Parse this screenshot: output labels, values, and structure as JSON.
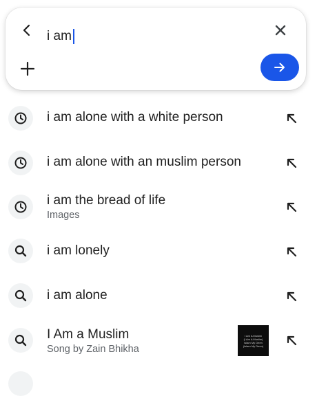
{
  "search": {
    "query": "i am",
    "back_icon": "arrow-left-icon",
    "clear_icon": "close-icon",
    "add_icon": "plus-icon",
    "submit_icon": "arrow-right-icon",
    "accent_color": "#1a56e8"
  },
  "suggestions": [
    {
      "icon": "history-clock-icon",
      "title": "i am alone with a white person"
    },
    {
      "icon": "history-clock-icon",
      "title": "i am alone with an muslim person"
    },
    {
      "icon": "history-clock-icon",
      "title": "i am the bread of life",
      "subtitle": "Images"
    },
    {
      "icon": "search-icon",
      "title": "i am lonely"
    },
    {
      "icon": "search-icon",
      "title": "i am alone"
    },
    {
      "icon": "search-icon",
      "title": "I Am a Muslim",
      "subtitle": "Song by Zain Bhikha",
      "thumbnail_lines": [
        "I Am A Muslim",
        "(I Am A Muslim)",
        "Islam My Deen",
        "(Islam My Deen)"
      ]
    }
  ]
}
